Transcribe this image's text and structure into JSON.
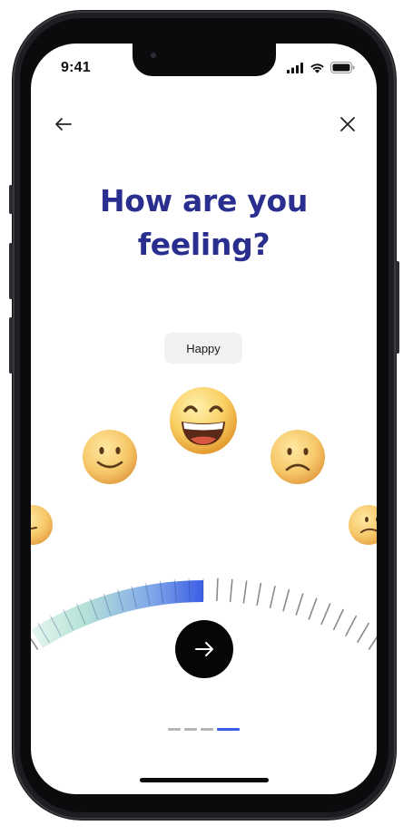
{
  "status_bar": {
    "time": "9:41"
  },
  "nav": {
    "back_icon": "arrow-left-icon",
    "close_icon": "close-icon"
  },
  "header": {
    "title_line1": "How are you",
    "title_line2": "feeling?"
  },
  "mood": {
    "selected_label": "Happy",
    "emojis": [
      {
        "name": "slightly-confused-face",
        "position": "far-left"
      },
      {
        "name": "slightly-smiling-face",
        "position": "left"
      },
      {
        "name": "grinning-face-with-smiling-eyes",
        "position": "center",
        "selected": true
      },
      {
        "name": "frowning-face",
        "position": "right"
      },
      {
        "name": "confused-face",
        "position": "far-right"
      }
    ]
  },
  "slider": {
    "selected_fraction": 0.5
  },
  "actions": {
    "next_icon": "arrow-right-icon"
  },
  "pager": {
    "total": 4,
    "active_index": 3
  },
  "colors": {
    "title": "#2a2f8f",
    "accent": "#3b5ce6",
    "button": "#060606",
    "pill_bg": "#f1f1f3",
    "gradient_start": "#dff3ec",
    "gradient_end": "#3b5ce6"
  }
}
